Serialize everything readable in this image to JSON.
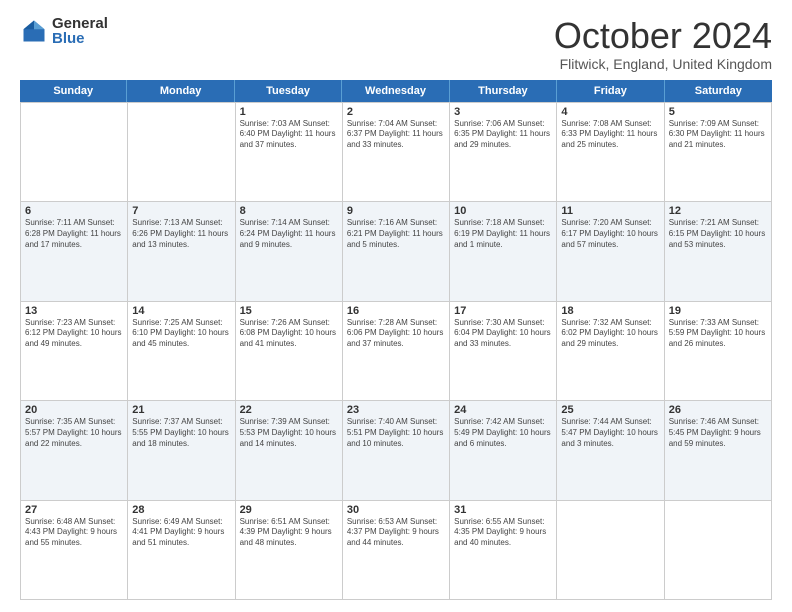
{
  "logo": {
    "general": "General",
    "blue": "Blue"
  },
  "title": "October 2024",
  "location": "Flitwick, England, United Kingdom",
  "days_of_week": [
    "Sunday",
    "Monday",
    "Tuesday",
    "Wednesday",
    "Thursday",
    "Friday",
    "Saturday"
  ],
  "weeks": [
    [
      {
        "day": "",
        "info": ""
      },
      {
        "day": "",
        "info": ""
      },
      {
        "day": "1",
        "info": "Sunrise: 7:03 AM\nSunset: 6:40 PM\nDaylight: 11 hours and 37 minutes."
      },
      {
        "day": "2",
        "info": "Sunrise: 7:04 AM\nSunset: 6:37 PM\nDaylight: 11 hours and 33 minutes."
      },
      {
        "day": "3",
        "info": "Sunrise: 7:06 AM\nSunset: 6:35 PM\nDaylight: 11 hours and 29 minutes."
      },
      {
        "day": "4",
        "info": "Sunrise: 7:08 AM\nSunset: 6:33 PM\nDaylight: 11 hours and 25 minutes."
      },
      {
        "day": "5",
        "info": "Sunrise: 7:09 AM\nSunset: 6:30 PM\nDaylight: 11 hours and 21 minutes."
      }
    ],
    [
      {
        "day": "6",
        "info": "Sunrise: 7:11 AM\nSunset: 6:28 PM\nDaylight: 11 hours and 17 minutes."
      },
      {
        "day": "7",
        "info": "Sunrise: 7:13 AM\nSunset: 6:26 PM\nDaylight: 11 hours and 13 minutes."
      },
      {
        "day": "8",
        "info": "Sunrise: 7:14 AM\nSunset: 6:24 PM\nDaylight: 11 hours and 9 minutes."
      },
      {
        "day": "9",
        "info": "Sunrise: 7:16 AM\nSunset: 6:21 PM\nDaylight: 11 hours and 5 minutes."
      },
      {
        "day": "10",
        "info": "Sunrise: 7:18 AM\nSunset: 6:19 PM\nDaylight: 11 hours and 1 minute."
      },
      {
        "day": "11",
        "info": "Sunrise: 7:20 AM\nSunset: 6:17 PM\nDaylight: 10 hours and 57 minutes."
      },
      {
        "day": "12",
        "info": "Sunrise: 7:21 AM\nSunset: 6:15 PM\nDaylight: 10 hours and 53 minutes."
      }
    ],
    [
      {
        "day": "13",
        "info": "Sunrise: 7:23 AM\nSunset: 6:12 PM\nDaylight: 10 hours and 49 minutes."
      },
      {
        "day": "14",
        "info": "Sunrise: 7:25 AM\nSunset: 6:10 PM\nDaylight: 10 hours and 45 minutes."
      },
      {
        "day": "15",
        "info": "Sunrise: 7:26 AM\nSunset: 6:08 PM\nDaylight: 10 hours and 41 minutes."
      },
      {
        "day": "16",
        "info": "Sunrise: 7:28 AM\nSunset: 6:06 PM\nDaylight: 10 hours and 37 minutes."
      },
      {
        "day": "17",
        "info": "Sunrise: 7:30 AM\nSunset: 6:04 PM\nDaylight: 10 hours and 33 minutes."
      },
      {
        "day": "18",
        "info": "Sunrise: 7:32 AM\nSunset: 6:02 PM\nDaylight: 10 hours and 29 minutes."
      },
      {
        "day": "19",
        "info": "Sunrise: 7:33 AM\nSunset: 5:59 PM\nDaylight: 10 hours and 26 minutes."
      }
    ],
    [
      {
        "day": "20",
        "info": "Sunrise: 7:35 AM\nSunset: 5:57 PM\nDaylight: 10 hours and 22 minutes."
      },
      {
        "day": "21",
        "info": "Sunrise: 7:37 AM\nSunset: 5:55 PM\nDaylight: 10 hours and 18 minutes."
      },
      {
        "day": "22",
        "info": "Sunrise: 7:39 AM\nSunset: 5:53 PM\nDaylight: 10 hours and 14 minutes."
      },
      {
        "day": "23",
        "info": "Sunrise: 7:40 AM\nSunset: 5:51 PM\nDaylight: 10 hours and 10 minutes."
      },
      {
        "day": "24",
        "info": "Sunrise: 7:42 AM\nSunset: 5:49 PM\nDaylight: 10 hours and 6 minutes."
      },
      {
        "day": "25",
        "info": "Sunrise: 7:44 AM\nSunset: 5:47 PM\nDaylight: 10 hours and 3 minutes."
      },
      {
        "day": "26",
        "info": "Sunrise: 7:46 AM\nSunset: 5:45 PM\nDaylight: 9 hours and 59 minutes."
      }
    ],
    [
      {
        "day": "27",
        "info": "Sunrise: 6:48 AM\nSunset: 4:43 PM\nDaylight: 9 hours and 55 minutes."
      },
      {
        "day": "28",
        "info": "Sunrise: 6:49 AM\nSunset: 4:41 PM\nDaylight: 9 hours and 51 minutes."
      },
      {
        "day": "29",
        "info": "Sunrise: 6:51 AM\nSunset: 4:39 PM\nDaylight: 9 hours and 48 minutes."
      },
      {
        "day": "30",
        "info": "Sunrise: 6:53 AM\nSunset: 4:37 PM\nDaylight: 9 hours and 44 minutes."
      },
      {
        "day": "31",
        "info": "Sunrise: 6:55 AM\nSunset: 4:35 PM\nDaylight: 9 hours and 40 minutes."
      },
      {
        "day": "",
        "info": ""
      },
      {
        "day": "",
        "info": ""
      }
    ]
  ]
}
